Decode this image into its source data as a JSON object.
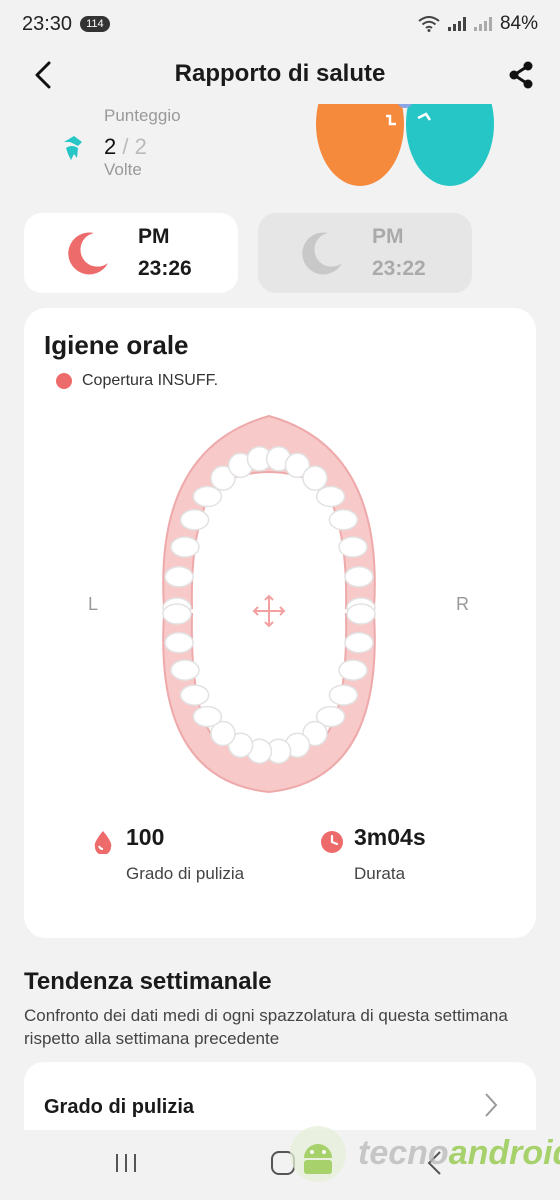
{
  "status_bar": {
    "time": "23:30",
    "badge": "114",
    "battery": "84%"
  },
  "header": {
    "title": "Rapporto di salute"
  },
  "score": {
    "label": "Punteggio",
    "value": "2",
    "separator": "/",
    "max": "2",
    "unit": "Volte"
  },
  "sessions": [
    {
      "period": "PM",
      "time": "23:26",
      "active": true
    },
    {
      "period": "PM",
      "time": "23:22",
      "active": false
    }
  ],
  "hygiene": {
    "title": "Igiene orale",
    "legend": "Copertura INSUFF.",
    "left_label": "L",
    "right_label": "R",
    "stats": [
      {
        "value": "100",
        "label": "Grado di pulizia",
        "icon": "drop-icon"
      },
      {
        "value": "3m04s",
        "label": "Durata",
        "icon": "clock-icon"
      }
    ]
  },
  "trend": {
    "title": "Tendenza settimanale",
    "description": "Confronto dei dati medi di ogni spazzolatura di questa settimana rispetto alla settimana precedente",
    "row_label": "Grado di pulizia"
  },
  "watermark": {
    "part1": "tecno",
    "part2": "android"
  },
  "colors": {
    "accent_red": "#ee6b6b",
    "teal": "#26c6c6",
    "orange": "#f5893c"
  }
}
